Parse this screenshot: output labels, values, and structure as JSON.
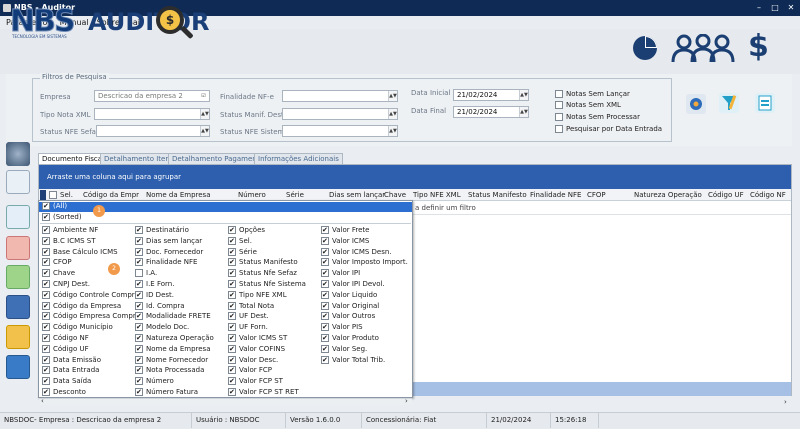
{
  "window": {
    "title": "NBS - Auditor",
    "controls": [
      "–",
      "□",
      "✕"
    ]
  },
  "menu": [
    "Parâmetros",
    "Manual",
    "Sobre",
    "Sair"
  ],
  "logo": {
    "nbs": "NBS",
    "auditor": "AUDITOR",
    "sub": "TECNOLOGIA EM SISTEMAS",
    "coin": "$"
  },
  "header_icons": [
    "pie-chart-icon",
    "users-icon",
    "dollar-icon"
  ],
  "filters": {
    "legend": "Filtros de Pesquisa",
    "empresa_label": "Empresa",
    "empresa_value": "Descricao da empresa 2",
    "tipo_nota_label": "Tipo Nota XML",
    "status_nfe_label": "Status NFE Sefaz",
    "finalidade_label": "Finalidade NF-e",
    "status_manif_label": "Status Manif. Dest:",
    "status_nfe_sistema_label": "Status NFE Sistema",
    "data_inicial_label": "Data Inicial",
    "data_inicial_value": "21/02/2024",
    "data_final_label": "Data Final",
    "data_final_value": "21/02/2024",
    "checks": [
      "Notas Sem Lançar",
      "Notas Sem XML",
      "Notas Sem Processar",
      "Pesquisar por Data Entrada"
    ]
  },
  "tabs": [
    "Documento Fiscais",
    "Detalhamento Itens",
    "Detalhamento Pagamento",
    "Informações Adicionais"
  ],
  "grid": {
    "group_hint": "Arraste uma coluna aqui para agrupar",
    "filter_hint": "a definir um filtro",
    "columns": [
      "Sel.",
      "Código da Empr",
      "Nome da Empresa",
      "Número",
      "Série",
      "Dias sem lançar",
      "Chave",
      "Tipo  NFE  XML",
      "Status Manifesto",
      "Finalidade NFE",
      "CFOP",
      "Natureza Operação",
      "Código UF",
      "Código NF"
    ]
  },
  "popup": {
    "all": "(All)",
    "sorted": "(Sorted)",
    "badge1": "1",
    "badge2": "2",
    "col1": [
      "Ambiente NF",
      "B.C ICMS ST",
      "Base Cálculo ICMS",
      "CFOP",
      "Chave",
      "CNPJ Dest.",
      "Código Controle Compra",
      "Código da Empresa",
      "Código Empresa Compra",
      "Código Município",
      "Código NF",
      "Código UF",
      "Data Emissão",
      "Data Entrada",
      "Data Saída",
      "Desconto"
    ],
    "col2": [
      "Destinatário",
      "Dias sem lançar",
      "Doc. Fornecedor",
      "Finalidade NFE",
      "I.A.",
      "I.E Forn.",
      "ID Dest.",
      "Id. Compra",
      "Modalidade FRETE",
      "Modelo Doc.",
      "Natureza Operação",
      "Nome da Empresa",
      "Nome Fornecedor",
      "Nota Processada",
      "Número",
      "Número Fatura"
    ],
    "col2_unchecked": [
      4
    ],
    "col3": [
      "Opções",
      "Sel.",
      "Série",
      "Status Manifesto",
      "Status Nfe Sefaz",
      "Status Nfe Sistema",
      "Tipo  NFE  XML",
      "Total Nota",
      "UF Dest.",
      "UF Forn.",
      "Valor  ICMS ST",
      "Valor COFINS",
      "Valor Desc.",
      "Valor FCP",
      "Valor FCP ST",
      "Valor FCP ST RET"
    ],
    "col4": [
      "Valor Frete",
      "Valor ICMS",
      "Valor ICMS Desn.",
      "Valor Imposto Import.",
      "Valor IPI",
      "Valor IPI Devol.",
      "Valor Liquido",
      "Valor Original",
      "Valor Outros",
      "Valor PIS",
      "Valor Produto",
      "Valor Seg.",
      "Valor Total Trib."
    ]
  },
  "status": {
    "empresa": "NBSDOC- Empresa : Descricao da empresa 2",
    "usuario": "Usuário : NBSDOC",
    "versao": "Versão 1.6.0.0",
    "concessionaria": "Concessionária: Fiat",
    "data": "21/02/2024",
    "hora": "15:26:18"
  },
  "colors": {
    "titlebar": "#0f2a55",
    "groupbar": "#2d5fae",
    "selected": "#2d6fd0",
    "badge": "#f29a4b"
  }
}
